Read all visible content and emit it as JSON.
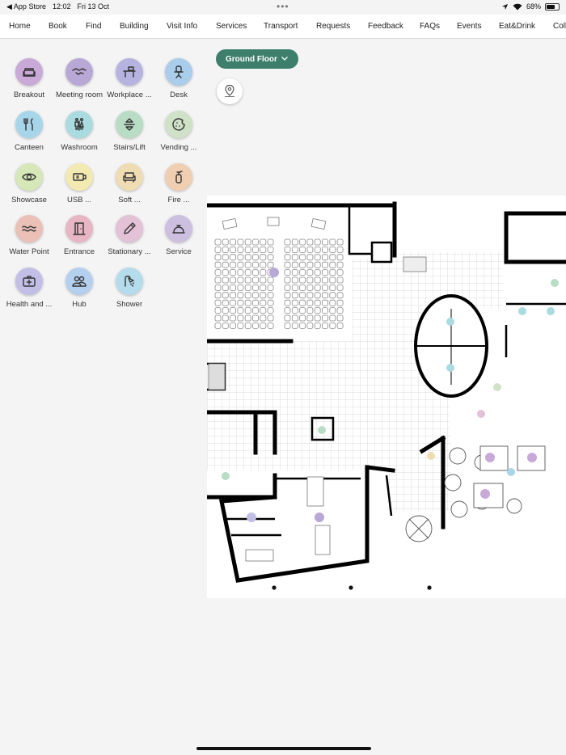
{
  "status_bar": {
    "back_app": "◀ App Store",
    "time": "12:02",
    "date": "Fri 13 Oct",
    "battery": "68%",
    "battery_level": 0.68
  },
  "nav": {
    "items": [
      "Home",
      "Book",
      "Find",
      "Building",
      "Visit Info",
      "Services",
      "Transport",
      "Requests",
      "Feedback",
      "FAQs",
      "Events",
      "Eat&Drink",
      "Coll"
    ]
  },
  "categories": [
    {
      "label": "Breakout",
      "icon": "sofa-icon",
      "color": "#c9a9d8"
    },
    {
      "label": "Meeting room",
      "icon": "handshake-icon",
      "color": "#b8a8d6"
    },
    {
      "label": "Workplace ...",
      "icon": "desk-icon",
      "color": "#b7b3e0"
    },
    {
      "label": "Desk",
      "icon": "chair-icon",
      "color": "#a9cdea"
    },
    {
      "label": "Canteen",
      "icon": "cutlery-icon",
      "color": "#a7d6ea"
    },
    {
      "label": "Washroom",
      "icon": "washroom-icon",
      "color": "#a9dbe0"
    },
    {
      "label": "Stairs/Lift",
      "icon": "lift-icon",
      "color": "#b8dcc4"
    },
    {
      "label": "Vending ...",
      "icon": "cookie-icon",
      "color": "#cfe1c7"
    },
    {
      "label": "Showcase",
      "icon": "eye-icon",
      "color": "#d6e7b8"
    },
    {
      "label": "USB ...",
      "icon": "usb-icon",
      "color": "#f2eab1"
    },
    {
      "label": "Soft ...",
      "icon": "armchair-icon",
      "color": "#f0dcb2"
    },
    {
      "label": "Fire ...",
      "icon": "extinguisher-icon",
      "color": "#f0ceb1"
    },
    {
      "label": "Water Point",
      "icon": "water-icon",
      "color": "#ebc0b7"
    },
    {
      "label": "Entrance",
      "icon": "door-icon",
      "color": "#e8b5c4"
    },
    {
      "label": "Stationary ...",
      "icon": "pencil-icon",
      "color": "#e3c1d6"
    },
    {
      "label": "Service",
      "icon": "bell-icon",
      "color": "#cdbfe0"
    },
    {
      "label": "Health and ...",
      "icon": "firstaid-icon",
      "color": "#c3bee6"
    },
    {
      "label": "Hub",
      "icon": "people-icon",
      "color": "#b5d0ee"
    },
    {
      "label": "Shower",
      "icon": "shower-icon",
      "color": "#b4dcec"
    }
  ],
  "floor_selector": {
    "label": "Ground Floor"
  },
  "colors": {
    "accent": "#3d7f6a"
  }
}
